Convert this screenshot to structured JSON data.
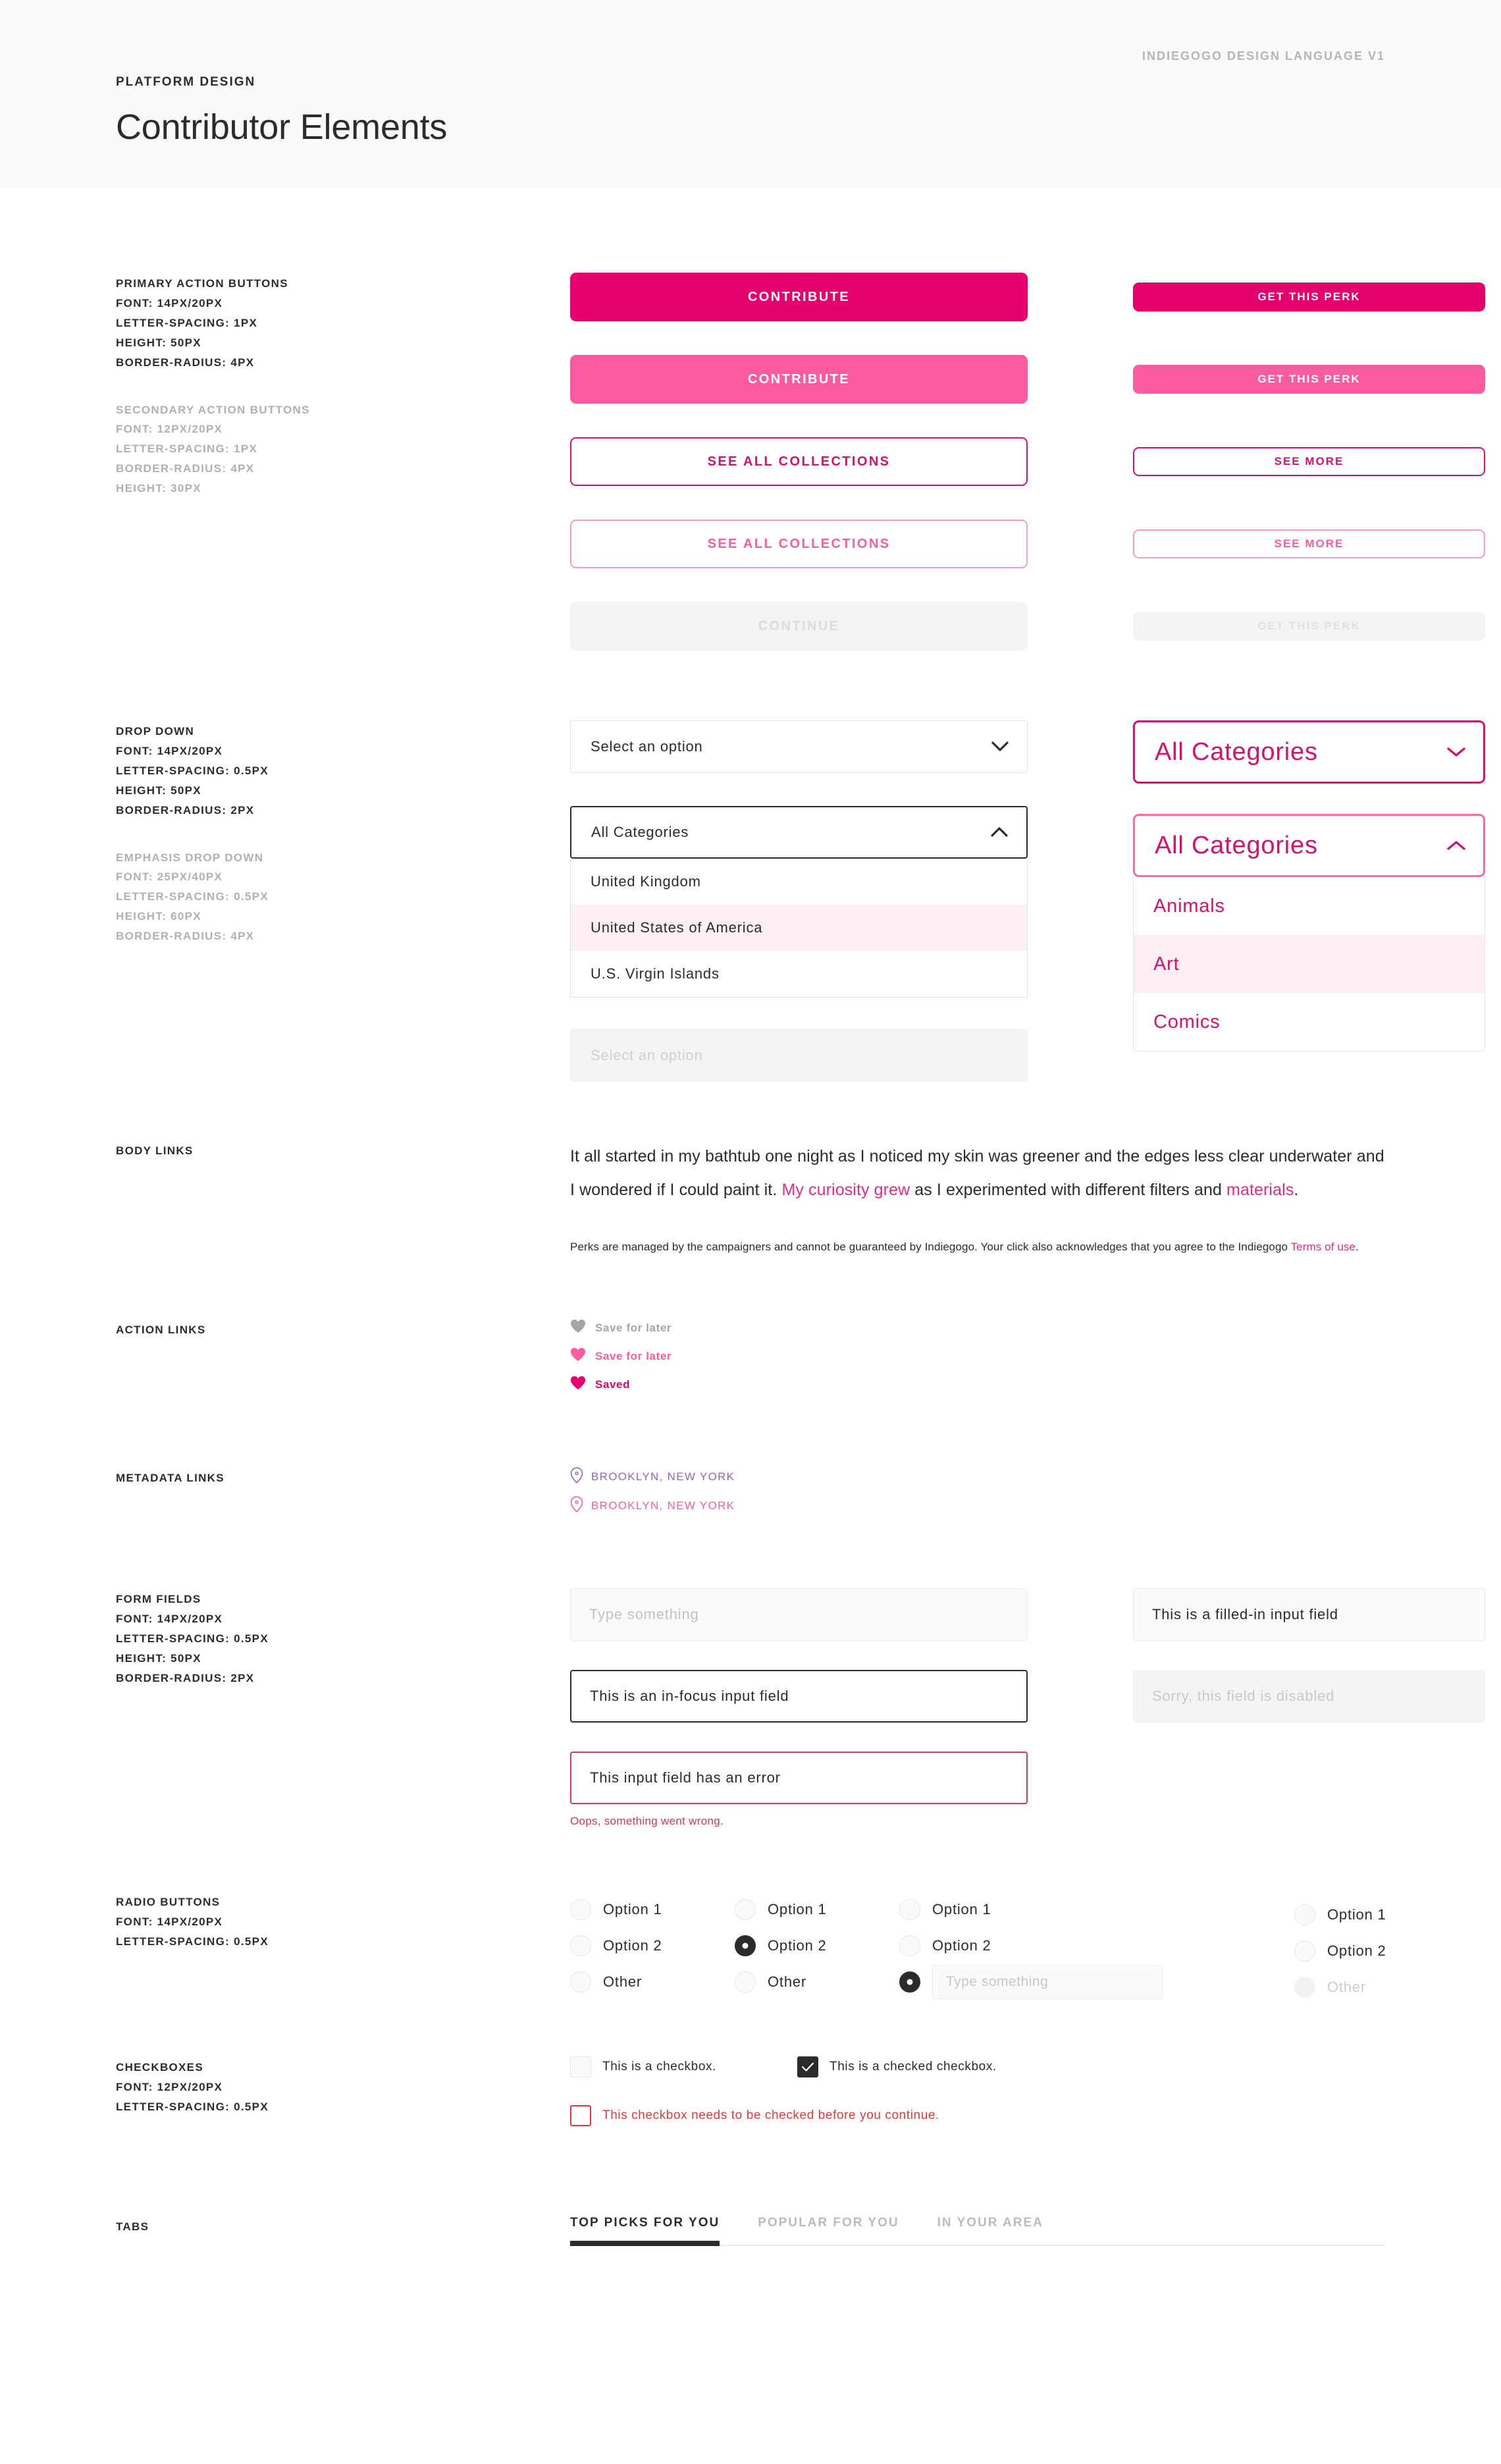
{
  "header": {
    "eyebrow": "PLATFORM DESIGN",
    "title": "Contributor Elements",
    "version": "INDIEGOGO DESIGN LANGUAGE V1"
  },
  "colors": {
    "primary_pink": "#E6006E",
    "hover_pink": "#FB5BA0",
    "link_pink": "#EA2A82",
    "error_red": "#D6365A",
    "checkbox_error_red": "#E23A3A",
    "purple": "#9B5FC0",
    "ink": "#2B2B2B",
    "muted": "#B0B0B0"
  },
  "specs": {
    "primary_buttons": {
      "title": "PRIMARY ACTION BUTTONS",
      "lines": [
        "FONT: 14PX/20PX",
        "LETTER-SPACING: 1PX",
        "HEIGHT: 50PX",
        "BORDER-RADIUS: 4PX"
      ]
    },
    "secondary_buttons": {
      "title": "SECONDARY ACTION BUTTONS",
      "lines": [
        "FONT: 12PX/20PX",
        "LETTER-SPACING: 1PX",
        "BORDER-RADIUS: 4PX",
        "HEIGHT: 30PX"
      ]
    },
    "drop_down": {
      "title": "DROP DOWN",
      "lines": [
        "FONT: 14PX/20PX",
        "LETTER-SPACING: 0.5PX",
        "HEIGHT: 50PX",
        "BORDER-RADIUS: 2PX"
      ]
    },
    "emphasis_drop_down": {
      "title": "EMPHASIS DROP DOWN",
      "lines": [
        "FONT: 25PX/40PX",
        "LETTER-SPACING: 0.5PX",
        "HEIGHT: 60PX",
        "BORDER-RADIUS: 4PX"
      ]
    },
    "body_links": {
      "title": "BODY LINKS",
      "lines": []
    },
    "action_links": {
      "title": "ACTION LINKS",
      "lines": []
    },
    "metadata_links": {
      "title": "METADATA LINKS",
      "lines": []
    },
    "form_fields": {
      "title": "FORM FIELDS",
      "lines": [
        "FONT: 14PX/20PX",
        "LETTER-SPACING: 0.5PX",
        "HEIGHT: 50PX",
        "BORDER-RADIUS: 2PX"
      ]
    },
    "radio_buttons": {
      "title": "RADIO BUTTONS",
      "lines": [
        "FONT: 14PX/20PX",
        "LETTER-SPACING: 0.5PX"
      ]
    },
    "checkboxes": {
      "title": "CHECKBOXES",
      "lines": [
        "FONT: 12PX/20PX",
        "LETTER-SPACING: 0.5PX"
      ]
    },
    "tabs": {
      "title": "TABS",
      "lines": []
    }
  },
  "buttons": {
    "contribute_default": "CONTRIBUTE",
    "contribute_hover": "CONTRIBUTE",
    "see_all_collections_default": "SEE ALL COLLECTIONS",
    "see_all_collections_hover": "SEE ALL COLLECTIONS",
    "continue_disabled": "CONTINUE",
    "get_this_perk_default": "GET THIS PERK",
    "get_this_perk_hover": "GET THIS PERK",
    "see_more_default": "SEE MORE",
    "see_more_hover": "SEE MORE",
    "get_this_perk_disabled": "GET THIS PERK"
  },
  "dropdowns": {
    "placeholder": "Select an option",
    "open_value": "All Categories",
    "open_options": [
      "United Kingdom",
      "United States of America",
      "U.S. Virgin Islands"
    ],
    "open_highlighted_index": 1,
    "disabled_value": "Select an option",
    "emphasis_closed_value": "All Categories",
    "emphasis_open_value": "All Categories",
    "emphasis_options": [
      "Animals",
      "Art",
      "Comics"
    ],
    "emphasis_highlighted_index": 1
  },
  "body_links": {
    "para_1": "It all started in my bathtub one night as I noticed my skin was greener and the edges less clear underwater and I wondered if I could paint it. ",
    "para_1_link_1": "My curiosity grew",
    "para_1_mid": " as I experimented with different filters and ",
    "para_1_link_2": "materials",
    "para_1_end": ".",
    "fine_print": "Perks are managed by the campaigners and cannot be guaranteed by Indiegogo. Your click also acknowledges that you agree to the Indiegogo ",
    "fine_print_link": "Terms of use",
    "fine_print_end": "."
  },
  "action_links": [
    {
      "label": "Save for later",
      "state": "default",
      "icon": "heart-icon"
    },
    {
      "label": "Save for later",
      "state": "hover",
      "icon": "heart-icon"
    },
    {
      "label": "Saved",
      "state": "saved",
      "icon": "heart-icon"
    }
  ],
  "metadata_links": [
    {
      "label": "BROOKLYN, NEW YORK",
      "state": "visited",
      "icon": "map-pin-icon"
    },
    {
      "label": "BROOKLYN, NEW YORK",
      "state": "hover",
      "icon": "map-pin-icon"
    }
  ],
  "form_fields": {
    "empty_placeholder": "Type something",
    "focus_value": "This is an in-focus input field",
    "error_value": "This input field has an error",
    "error_message": "Oops, something went wrong.",
    "filled_value": "This is a filled-in input field",
    "disabled_placeholder": "Sorry, this field is disabled"
  },
  "radios": {
    "group_1": [
      {
        "label": "Option 1",
        "selected": false
      },
      {
        "label": "Option 2",
        "selected": false
      },
      {
        "label": "Other",
        "selected": false
      }
    ],
    "group_2": [
      {
        "label": "Option 1",
        "selected": false
      },
      {
        "label": "Option 2",
        "selected": true
      },
      {
        "label": "Other",
        "selected": false
      }
    ],
    "group_3": [
      {
        "label": "Option 1",
        "selected": false
      },
      {
        "label": "Option 2",
        "selected": false
      },
      {
        "label": "",
        "selected": true
      }
    ],
    "group_3_other_placeholder": "Type something",
    "group_4": [
      {
        "label": "Option 1",
        "selected": false,
        "disabled": false
      },
      {
        "label": "Option 2",
        "selected": false,
        "disabled": false
      },
      {
        "label": "Other",
        "selected": false,
        "disabled": true
      }
    ]
  },
  "checkboxes": {
    "unchecked_label": "This is a checkbox.",
    "checked_label": "This is a checked checkbox.",
    "error_label": "This checkbox needs to be checked before you continue."
  },
  "tabs": [
    {
      "label": "TOP PICKS FOR YOU",
      "active": true
    },
    {
      "label": "POPULAR FOR YOU",
      "active": false
    },
    {
      "label": "IN YOUR AREA",
      "active": false
    }
  ]
}
